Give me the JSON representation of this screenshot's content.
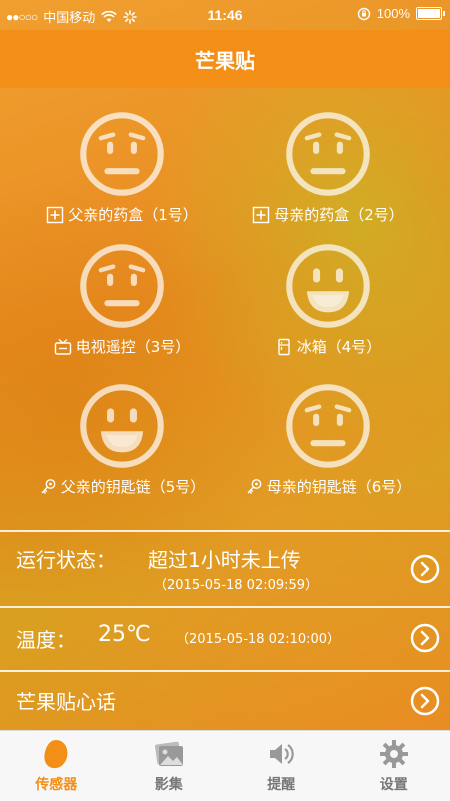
{
  "status_bar": {
    "signal": "●●○○○",
    "carrier": "中国移动",
    "time": "11:46",
    "battery": "100%"
  },
  "navbar": {
    "title": "芒果贴"
  },
  "sensors": [
    {
      "label": "父亲的药盒（1号）",
      "face": "worried",
      "icon": "medicine-box-icon"
    },
    {
      "label": "母亲的药盒（2号）",
      "face": "worried",
      "icon": "medicine-box-icon"
    },
    {
      "label": "电视遥控（3号）",
      "face": "worried",
      "icon": "tv-icon"
    },
    {
      "label": "冰箱（4号）",
      "face": "happy",
      "icon": "fridge-icon"
    },
    {
      "label": "父亲的钥匙链（5号）",
      "face": "happy",
      "icon": "key-icon"
    },
    {
      "label": "母亲的钥匙链（6号）",
      "face": "worried",
      "icon": "key-icon"
    }
  ],
  "status_row": {
    "title": "运行状态：",
    "value": "超过1小时未上传",
    "time": "（2015-05-18 02:09:59）"
  },
  "temp_row": {
    "title": "温度：",
    "value": "25℃",
    "time": "（2015-05-18 02:10:00）"
  },
  "talk_row": {
    "title": "芒果贴心话"
  },
  "tabs": [
    {
      "label": "传感器",
      "icon": "mango-icon",
      "active": true
    },
    {
      "label": "影集",
      "icon": "photo-icon",
      "active": false
    },
    {
      "label": "提醒",
      "icon": "speaker-icon",
      "active": false
    },
    {
      "label": "设置",
      "icon": "gear-icon",
      "active": false
    }
  ],
  "colors": {
    "accent": "#f38e16",
    "tab_inactive": "#777777"
  }
}
